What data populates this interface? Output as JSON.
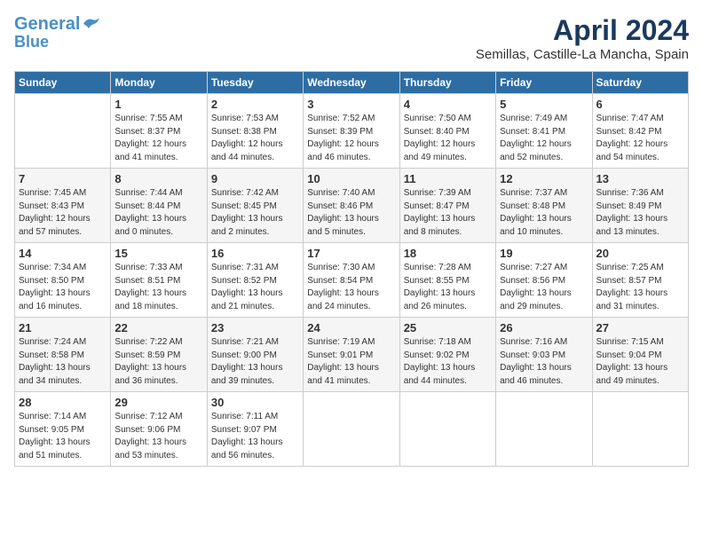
{
  "logo": {
    "line1": "General",
    "line2": "Blue"
  },
  "title": "April 2024",
  "subtitle": "Semillas, Castille-La Mancha, Spain",
  "columns": [
    "Sunday",
    "Monday",
    "Tuesday",
    "Wednesday",
    "Thursday",
    "Friday",
    "Saturday"
  ],
  "weeks": [
    [
      {
        "day": "",
        "info": ""
      },
      {
        "day": "1",
        "info": "Sunrise: 7:55 AM\nSunset: 8:37 PM\nDaylight: 12 hours\nand 41 minutes."
      },
      {
        "day": "2",
        "info": "Sunrise: 7:53 AM\nSunset: 8:38 PM\nDaylight: 12 hours\nand 44 minutes."
      },
      {
        "day": "3",
        "info": "Sunrise: 7:52 AM\nSunset: 8:39 PM\nDaylight: 12 hours\nand 46 minutes."
      },
      {
        "day": "4",
        "info": "Sunrise: 7:50 AM\nSunset: 8:40 PM\nDaylight: 12 hours\nand 49 minutes."
      },
      {
        "day": "5",
        "info": "Sunrise: 7:49 AM\nSunset: 8:41 PM\nDaylight: 12 hours\nand 52 minutes."
      },
      {
        "day": "6",
        "info": "Sunrise: 7:47 AM\nSunset: 8:42 PM\nDaylight: 12 hours\nand 54 minutes."
      }
    ],
    [
      {
        "day": "7",
        "info": "Sunrise: 7:45 AM\nSunset: 8:43 PM\nDaylight: 12 hours\nand 57 minutes."
      },
      {
        "day": "8",
        "info": "Sunrise: 7:44 AM\nSunset: 8:44 PM\nDaylight: 13 hours\nand 0 minutes."
      },
      {
        "day": "9",
        "info": "Sunrise: 7:42 AM\nSunset: 8:45 PM\nDaylight: 13 hours\nand 2 minutes."
      },
      {
        "day": "10",
        "info": "Sunrise: 7:40 AM\nSunset: 8:46 PM\nDaylight: 13 hours\nand 5 minutes."
      },
      {
        "day": "11",
        "info": "Sunrise: 7:39 AM\nSunset: 8:47 PM\nDaylight: 13 hours\nand 8 minutes."
      },
      {
        "day": "12",
        "info": "Sunrise: 7:37 AM\nSunset: 8:48 PM\nDaylight: 13 hours\nand 10 minutes."
      },
      {
        "day": "13",
        "info": "Sunrise: 7:36 AM\nSunset: 8:49 PM\nDaylight: 13 hours\nand 13 minutes."
      }
    ],
    [
      {
        "day": "14",
        "info": "Sunrise: 7:34 AM\nSunset: 8:50 PM\nDaylight: 13 hours\nand 16 minutes."
      },
      {
        "day": "15",
        "info": "Sunrise: 7:33 AM\nSunset: 8:51 PM\nDaylight: 13 hours\nand 18 minutes."
      },
      {
        "day": "16",
        "info": "Sunrise: 7:31 AM\nSunset: 8:52 PM\nDaylight: 13 hours\nand 21 minutes."
      },
      {
        "day": "17",
        "info": "Sunrise: 7:30 AM\nSunset: 8:54 PM\nDaylight: 13 hours\nand 24 minutes."
      },
      {
        "day": "18",
        "info": "Sunrise: 7:28 AM\nSunset: 8:55 PM\nDaylight: 13 hours\nand 26 minutes."
      },
      {
        "day": "19",
        "info": "Sunrise: 7:27 AM\nSunset: 8:56 PM\nDaylight: 13 hours\nand 29 minutes."
      },
      {
        "day": "20",
        "info": "Sunrise: 7:25 AM\nSunset: 8:57 PM\nDaylight: 13 hours\nand 31 minutes."
      }
    ],
    [
      {
        "day": "21",
        "info": "Sunrise: 7:24 AM\nSunset: 8:58 PM\nDaylight: 13 hours\nand 34 minutes."
      },
      {
        "day": "22",
        "info": "Sunrise: 7:22 AM\nSunset: 8:59 PM\nDaylight: 13 hours\nand 36 minutes."
      },
      {
        "day": "23",
        "info": "Sunrise: 7:21 AM\nSunset: 9:00 PM\nDaylight: 13 hours\nand 39 minutes."
      },
      {
        "day": "24",
        "info": "Sunrise: 7:19 AM\nSunset: 9:01 PM\nDaylight: 13 hours\nand 41 minutes."
      },
      {
        "day": "25",
        "info": "Sunrise: 7:18 AM\nSunset: 9:02 PM\nDaylight: 13 hours\nand 44 minutes."
      },
      {
        "day": "26",
        "info": "Sunrise: 7:16 AM\nSunset: 9:03 PM\nDaylight: 13 hours\nand 46 minutes."
      },
      {
        "day": "27",
        "info": "Sunrise: 7:15 AM\nSunset: 9:04 PM\nDaylight: 13 hours\nand 49 minutes."
      }
    ],
    [
      {
        "day": "28",
        "info": "Sunrise: 7:14 AM\nSunset: 9:05 PM\nDaylight: 13 hours\nand 51 minutes."
      },
      {
        "day": "29",
        "info": "Sunrise: 7:12 AM\nSunset: 9:06 PM\nDaylight: 13 hours\nand 53 minutes."
      },
      {
        "day": "30",
        "info": "Sunrise: 7:11 AM\nSunset: 9:07 PM\nDaylight: 13 hours\nand 56 minutes."
      },
      {
        "day": "",
        "info": ""
      },
      {
        "day": "",
        "info": ""
      },
      {
        "day": "",
        "info": ""
      },
      {
        "day": "",
        "info": ""
      }
    ]
  ]
}
